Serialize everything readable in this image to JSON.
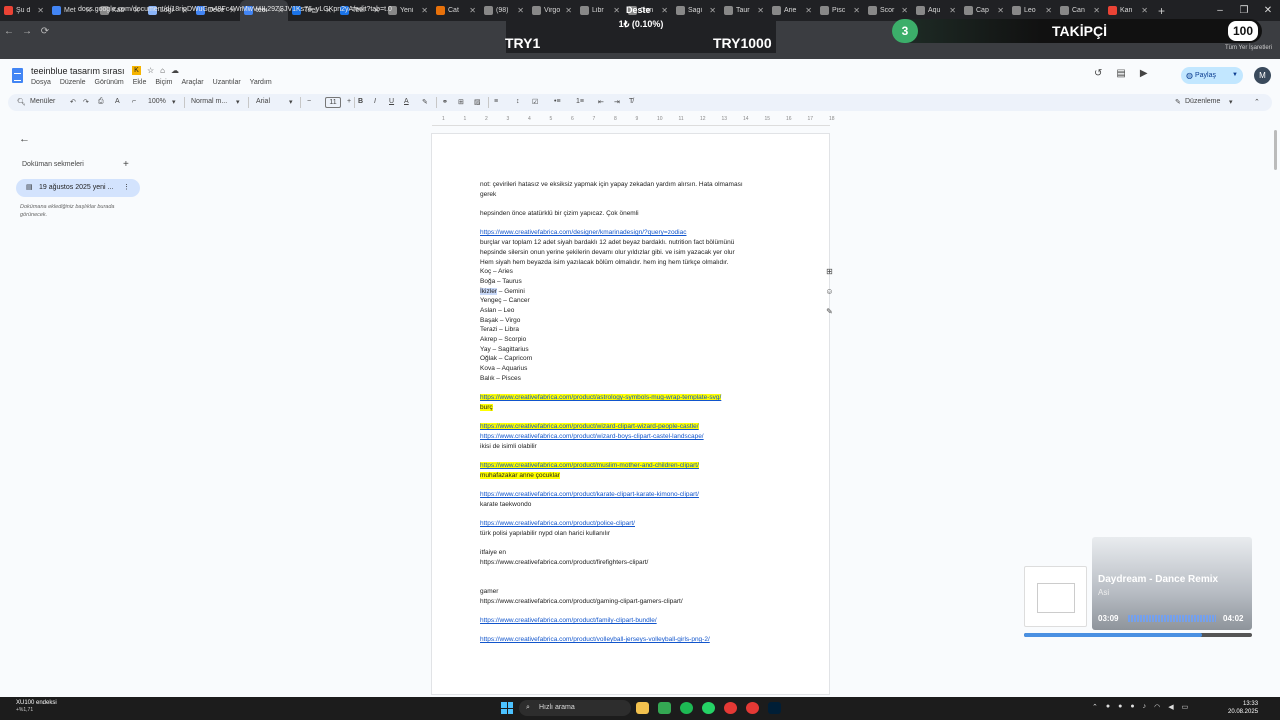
{
  "browser": {
    "tabs": [
      {
        "title": "Şu d",
        "color": "#ea4335"
      },
      {
        "title": "Met",
        "color": "#4285f4"
      },
      {
        "title": "Kab",
        "color": "#888888"
      },
      {
        "title": "Logi",
        "color": "#8ab4f8"
      },
      {
        "title": "Dece",
        "color": "#4285f4"
      },
      {
        "title": "teeı",
        "color": "#4285f4",
        "active": true
      },
      {
        "title": "Teel",
        "color": "#1a73e8"
      },
      {
        "title": "Teel",
        "color": "#1a73e8"
      },
      {
        "title": "Yeni",
        "color": "#888888"
      },
      {
        "title": "Cat",
        "color": "#e8710a"
      },
      {
        "title": "(98)",
        "color": "#888888"
      },
      {
        "title": "Virgo",
        "color": "#888888"
      },
      {
        "title": "Libr",
        "color": "#888888"
      },
      {
        "title": "Gen",
        "color": "#888888"
      },
      {
        "title": "Sagi",
        "color": "#888888"
      },
      {
        "title": "Taur",
        "color": "#888888"
      },
      {
        "title": "Arie",
        "color": "#888888"
      },
      {
        "title": "Pisc",
        "color": "#888888"
      },
      {
        "title": "Scor",
        "color": "#888888"
      },
      {
        "title": "Aqu",
        "color": "#888888"
      },
      {
        "title": "Cap",
        "color": "#888888"
      },
      {
        "title": "Leo",
        "color": "#888888"
      },
      {
        "title": "Can",
        "color": "#888888"
      },
      {
        "title": "Kan",
        "color": "#ea4335"
      }
    ],
    "url": "docs.google.com/document/d/18ripDWuGm48Fc4WrMwV4IL29ZSJV1Ks76_yLGKpn2yA/edit?tab=t.0",
    "all_bookmarks": "Tüm Yer İşaretleri"
  },
  "overlay": {
    "deste": "Deste",
    "percent": "1₺ (0.10%)",
    "try_left": "TRY1",
    "try_right": "TRY1000",
    "takipci_num": "3",
    "takipci_label": "TAKİPÇİ",
    "takipci_count": "100"
  },
  "docs": {
    "title": "teeinblue tasarım sırası",
    "menu": [
      "Dosya",
      "Düzenle",
      "Görünüm",
      "Ekle",
      "Biçim",
      "Araçlar",
      "Uzantılar",
      "Yardım"
    ],
    "share": "Paylaş",
    "avatar": "M",
    "toolbar": {
      "search": "Menüler",
      "zoom": "100%",
      "style": "Normal m...",
      "font": "Arial",
      "size": "11",
      "mode": "Düzenleme"
    },
    "sidebar": {
      "heading": "Doküman sekmeleri",
      "tab": "19 ağustos 2025 yeni ...",
      "hint": "Dokümana eklediğiniz başlıklar burada görünecek."
    },
    "ruler": [
      "1",
      "1",
      "2",
      "3",
      "4",
      "5",
      "6",
      "7",
      "8",
      "9",
      "10",
      "11",
      "12",
      "13",
      "14",
      "15",
      "16",
      "17",
      "18"
    ],
    "lines": [
      {
        "text": "not: çevirileri hatasız ve eksiksiz yapmak için yapay zekadan yardım alırsın. Hata olmaması"
      },
      {
        "text": "gerek"
      },
      {
        "gap": true
      },
      {
        "text": "hepsinden önce atatürklü bir çizim yapıcaz. Çok önemli"
      },
      {
        "gap": true
      },
      {
        "text": "https://www.creativefabrica.com/designer/kmarinadesign/?query=zodiac",
        "type": "link"
      },
      {
        "text": "burçlar var toplam 12 adet siyah bardaklı 12 adet beyaz bardaklı. nutrition fact bölümünü"
      },
      {
        "text": "hepsinde silersin onun yerine şekilerin devamı olur yıldızlar gibi. ve isim yazacak yer olur"
      },
      {
        "text": "Hem siyah hem beyazda isim yazılacak bölüm olmalıdır. hem ing hem türkçe olmalıdır."
      },
      {
        "text": "Koç – Aries"
      },
      {
        "text": "Boğa – Taurus"
      },
      {
        "text": "İkizler – Gemini",
        "selected": "İkizler"
      },
      {
        "text": "Yengeç – Cancer"
      },
      {
        "text": "Aslan – Leo"
      },
      {
        "text": "Başak – Virgo"
      },
      {
        "text": "Terazi – Libra"
      },
      {
        "text": "Akrep – Scorpio"
      },
      {
        "text": "Yay – Sagittarius"
      },
      {
        "text": "Oğlak – Capricorn"
      },
      {
        "text": "Kova – Aquarius"
      },
      {
        "text": "Balık – Pisces"
      },
      {
        "gap": true
      },
      {
        "text": "https://www.creativefabrica.com/product/astrology-symbols-mug-wrap-template-svg/",
        "type": "hl-link"
      },
      {
        "text": "burç",
        "type": "hl"
      },
      {
        "gap": true
      },
      {
        "text": "https://www.creativefabrica.com/product/wizard-clipart-wizard-people-castle/",
        "type": "hl-link"
      },
      {
        "text": "https://www.creativefabrica.com/product/wizard-boys-clipart-castel-landscape/",
        "type": "link"
      },
      {
        "text": "ikisi de isimli olabilir"
      },
      {
        "gap": true
      },
      {
        "text": "https://www.creativefabrica.com/product/muslim-mother-and-children-clipart/",
        "type": "hl-link"
      },
      {
        "text": "muhafazakar anne çocuklar",
        "type": "hl"
      },
      {
        "gap": true
      },
      {
        "text": "https://www.creativefabrica.com/product/karate-clipart-karate-kimono-clipart/",
        "type": "link"
      },
      {
        "text": "karate taekwondo"
      },
      {
        "gap": true
      },
      {
        "text": "https://www.creativefabrica.com/product/police-clipart/",
        "type": "link"
      },
      {
        "text": "türk polisi yapılabilir nypd olan harici kullanılır"
      },
      {
        "gap": true
      },
      {
        "text": "itfaiye en"
      },
      {
        "text": "https://www.creativefabrica.com/product/firefighters-clipart/"
      },
      {
        "gap": true
      },
      {
        "gap": true
      },
      {
        "text": "gamer"
      },
      {
        "text": "https://www.creativefabrica.com/product/gaming-clipart-gamers-clipart/"
      },
      {
        "gap": true
      },
      {
        "text": "https://www.creativefabrica.com/product/family-clipart-bundle/",
        "type": "link"
      },
      {
        "gap": true
      },
      {
        "text": "https://www.creativefabrica.com/product/volleyball-jerseys-volleyball-girls-png-2/",
        "type": "link"
      }
    ]
  },
  "music": {
    "song": "Daydream - Dance Remix",
    "artist": "Asi",
    "elapsed": "03:09",
    "total": "04:02",
    "progress": 0.78
  },
  "taskbar": {
    "weather_title": "XU100 endeksi",
    "weather_sub": "+%1,71",
    "search": "Hızlı arama",
    "time": "13:33",
    "date": "20.08.2025"
  }
}
